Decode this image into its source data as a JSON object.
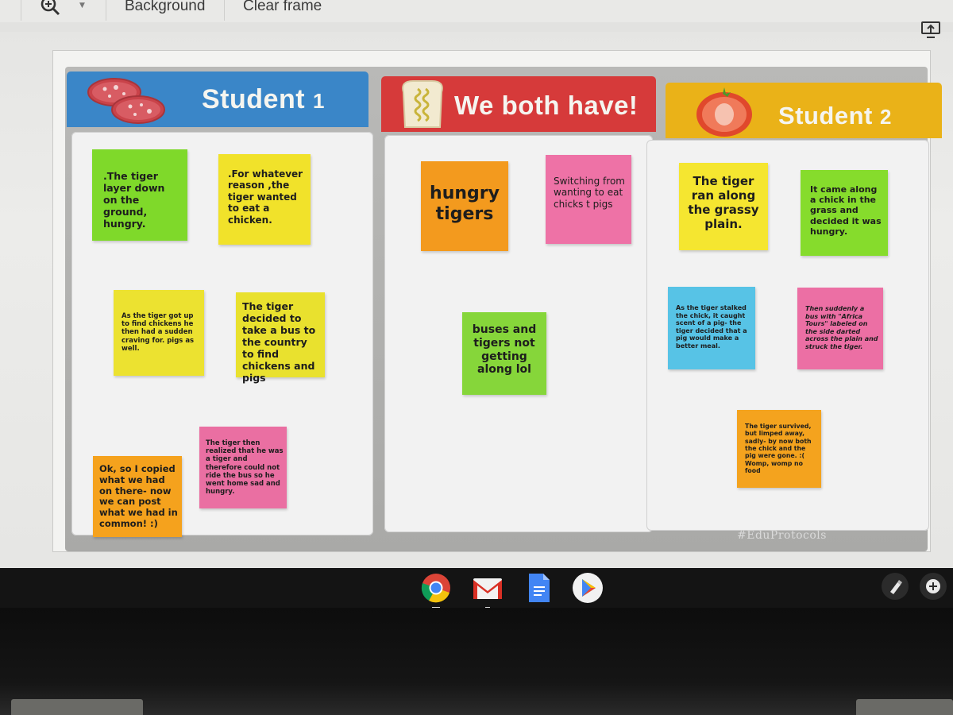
{
  "toolbar": {
    "zoom_icon": "zoom-in-icon",
    "background_label": "Background",
    "clear_frame_label": "Clear frame",
    "present_icon": "present-icon"
  },
  "board": {
    "watermark": "#EduProtocols",
    "columns": [
      {
        "title": "Student",
        "number": "1",
        "icon": "salami-icon",
        "color": "#3a86c8",
        "notes": [
          {
            "text": ".The tiger layer down on the ground, hungry.",
            "color": "#7fd92a"
          },
          {
            "text": ".For whatever reason ,the tiger wanted to eat a chicken.",
            "color": "#f1e22a"
          },
          {
            "text": "As the tiger got up to find chickens he then had a sudden craving for. pigs as well.",
            "color": "#ece230"
          },
          {
            "text": "The tiger decided to take a bus to the country to find chickens and pigs",
            "color": "#e9e12e"
          },
          {
            "text": "The tiger then realized that he was a tiger and therefore could not ride the bus so he went home sad and hungry.",
            "color": "#ea6fa2"
          },
          {
            "text": "Ok, so I copied what we had on there- now we can post what we had in common! :)",
            "color": "#f5a21d"
          }
        ]
      },
      {
        "title": "We both have!",
        "number": "",
        "icon": "bread-icon",
        "color": "#d63a3a",
        "notes": [
          {
            "text": "hungry tigers",
            "color": "#f39a1e"
          },
          {
            "text": "Switching from wanting to eat chicks t pigs",
            "color": "#ee72a6"
          },
          {
            "text": "buses and tigers not getting along lol",
            "color": "#86d63a"
          }
        ]
      },
      {
        "title": "Student",
        "number": "2",
        "icon": "tomato-icon",
        "color": "#eab218",
        "notes": [
          {
            "text": "The tiger ran along the grassy plain.",
            "color": "#f5e630"
          },
          {
            "text": "It came along a chick in the grass and decided it was hungry.",
            "color": "#86dc2c"
          },
          {
            "text": "As the tiger stalked the chick, it caught scent of a pig- the tiger decided that a pig would make a better meal.",
            "color": "#57c3e6"
          },
          {
            "text": "Then suddenly a bus with \"Africa Tours\" labeled on the side darted across the plain and struck the tiger.",
            "color": "#ec6fa4"
          },
          {
            "text": "The tiger survived, but limped away, sadly- by now both the chick and the pig were gone. :( Womp, womp no food",
            "color": "#f4a31e"
          }
        ]
      }
    ]
  },
  "shelf": {
    "apps": [
      {
        "name": "Chrome",
        "icon": "chrome-icon",
        "running": true
      },
      {
        "name": "Gmail",
        "icon": "gmail-icon",
        "running": true
      },
      {
        "name": "Docs",
        "icon": "docs-icon",
        "running": false
      },
      {
        "name": "Play Store",
        "icon": "play-store-icon",
        "running": false
      }
    ],
    "stylus_icon": "stylus-icon",
    "add_icon": "add-icon"
  }
}
